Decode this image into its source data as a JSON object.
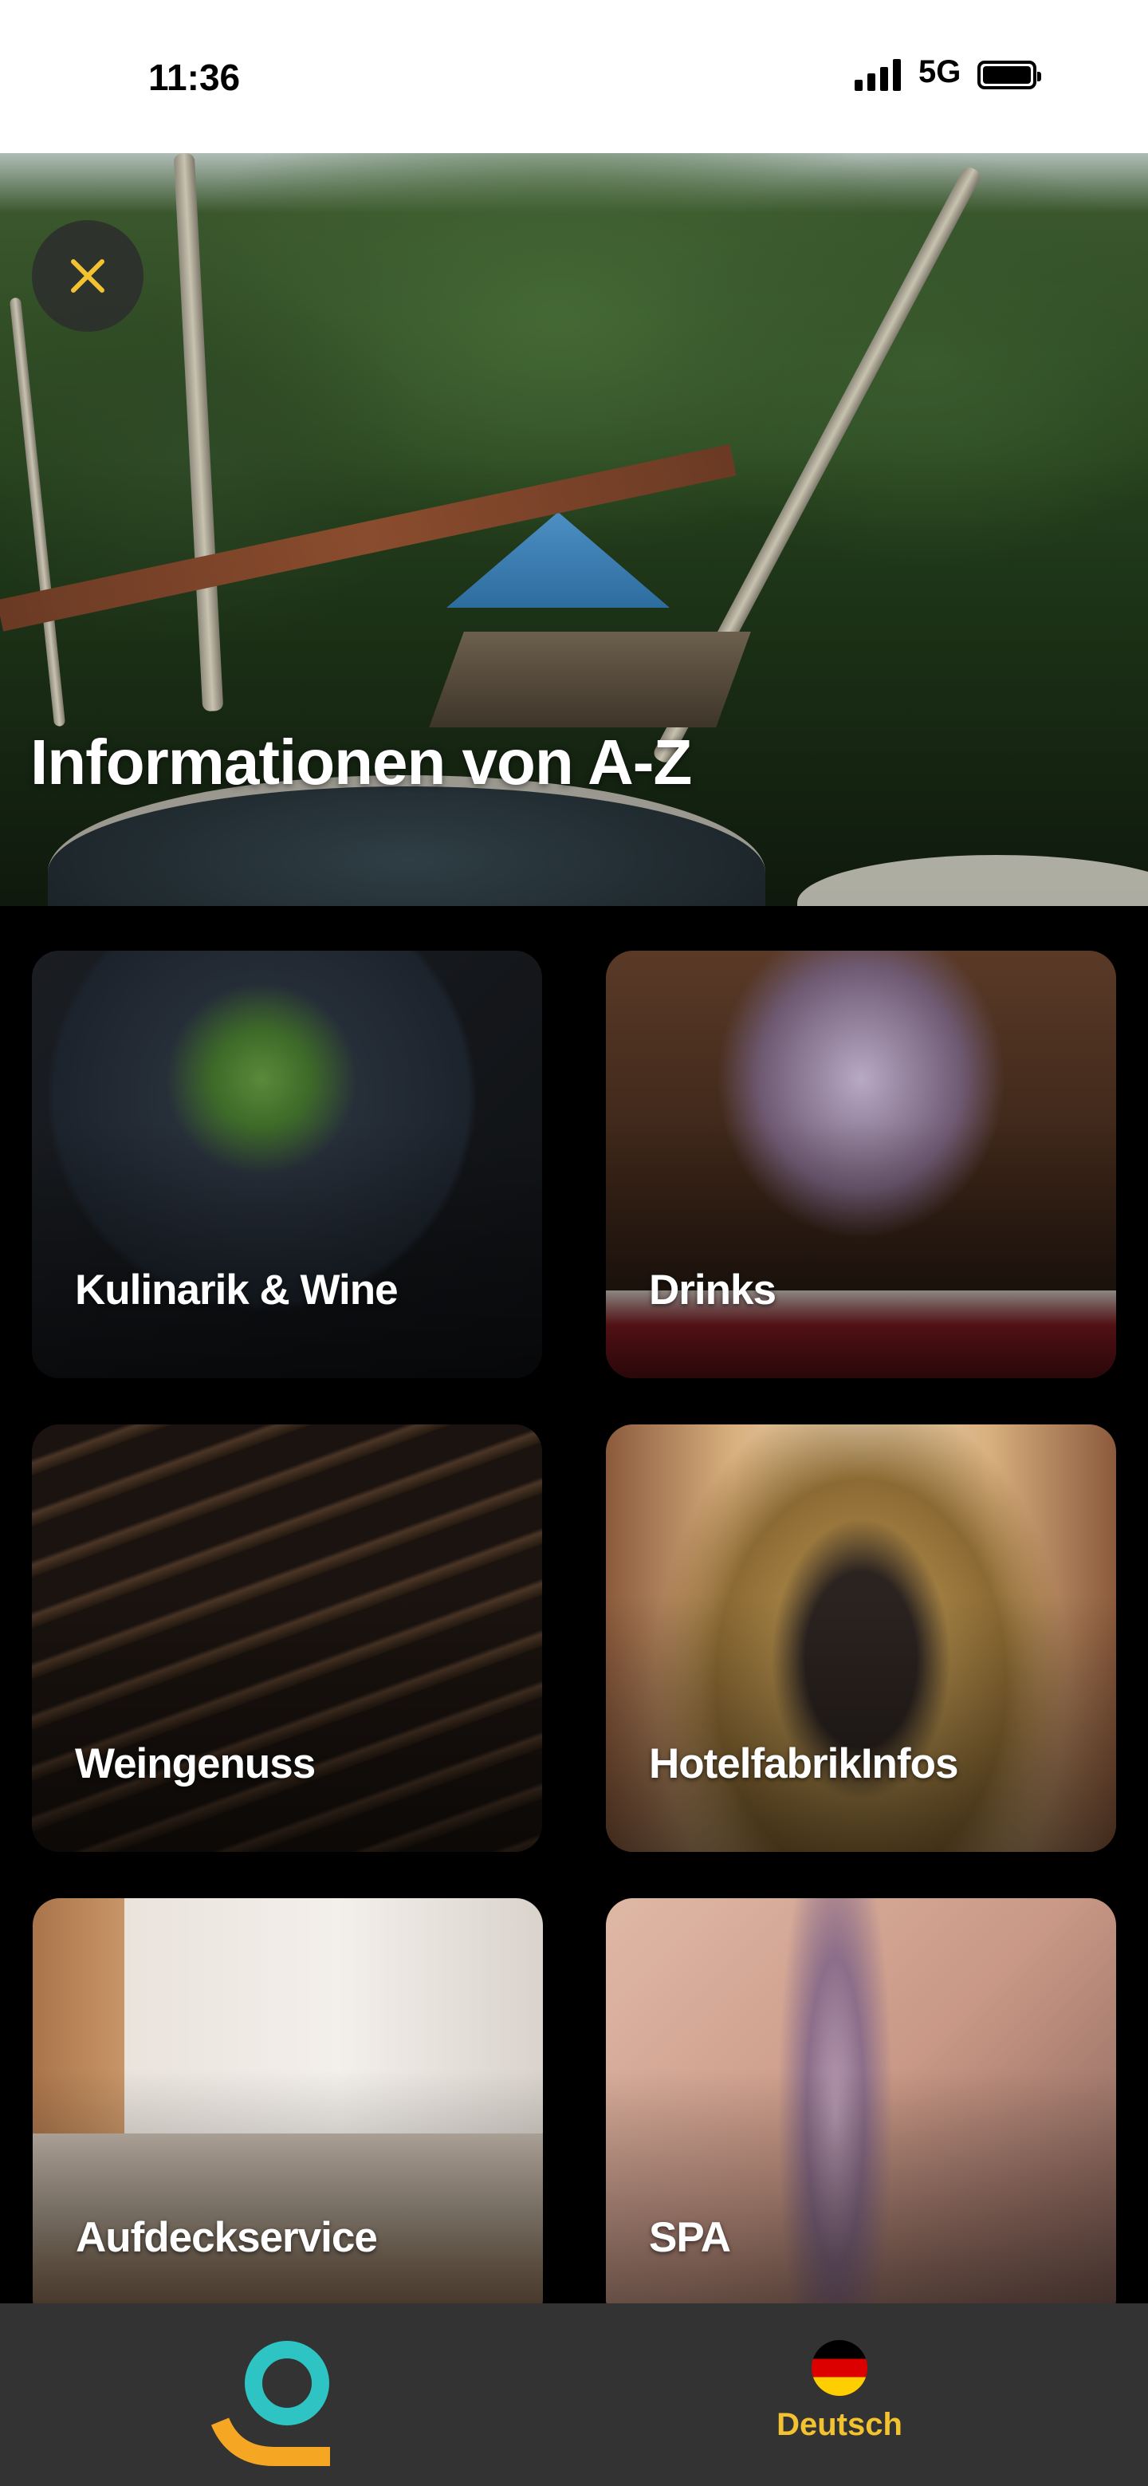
{
  "status_bar": {
    "time": "11:36",
    "network": "5G"
  },
  "hero": {
    "title": "Informationen von A-Z"
  },
  "categories": [
    {
      "label": "Kulinarik & Wine"
    },
    {
      "label": "Drinks"
    },
    {
      "label": "Weingenuss"
    },
    {
      "label": "HotelfabrikInfos"
    },
    {
      "label": "Aufdeckservice"
    },
    {
      "label": "SPA"
    }
  ],
  "bottom_nav": {
    "language_label": "Deutsch"
  },
  "colors": {
    "accent": "#f2c230",
    "logo_teal": "#2ec4c4",
    "logo_orange": "#f5a623"
  }
}
